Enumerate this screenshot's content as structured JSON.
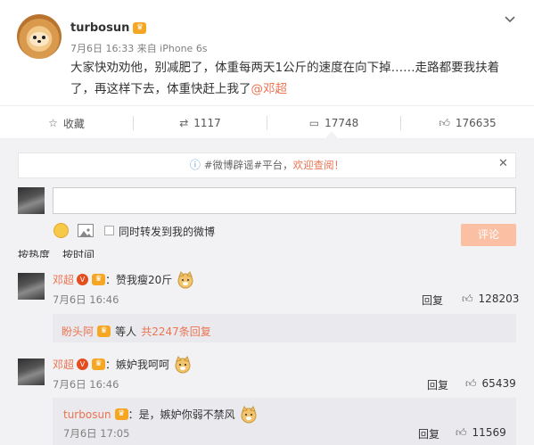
{
  "post": {
    "username": "turbosun",
    "meta": "7月6日 16:33 来自 iPhone 6s",
    "text_line1": "大家快劝劝他，别减肥了，体重每两天1公斤的速度在向下掉……走路都要我扶着",
    "text_line2_prefix": "了，再这样下去，体重快赶上我了",
    "mention": "@邓超"
  },
  "actions": {
    "favorite": "收藏",
    "repost": "1117",
    "comment": "17748",
    "like": "176635"
  },
  "notice": {
    "tag": "#微博辟谣#平台，",
    "link": "欢迎查阅！"
  },
  "composer": {
    "checkbox_label": "同时转发到我的微博",
    "submit": "评论"
  },
  "sort_tabs": [
    "按热度",
    "按时间"
  ],
  "comments": [
    {
      "name": "邓超",
      "text": "：赞我瘦20斤",
      "time": "7月6日 16:46",
      "reply": "回复",
      "likes": "128203",
      "sub": {
        "name": "盼头阿",
        "text": "等人",
        "more": "共2247条回复"
      }
    },
    {
      "name": "邓超",
      "text": "：嫉妒我呵呵",
      "time": "7月6日 16:46",
      "reply": "回复",
      "likes": "65439",
      "sub": {
        "name": "turbosun",
        "text": "：是，嫉妒你弱不禁风",
        "time": "7月6日 17:05",
        "reply": "回复",
        "likes": "11569"
      }
    }
  ],
  "colors": {
    "accent": "#eb7350",
    "vip": "#f5a623",
    "submit_disabled": "#fbbfa3"
  }
}
